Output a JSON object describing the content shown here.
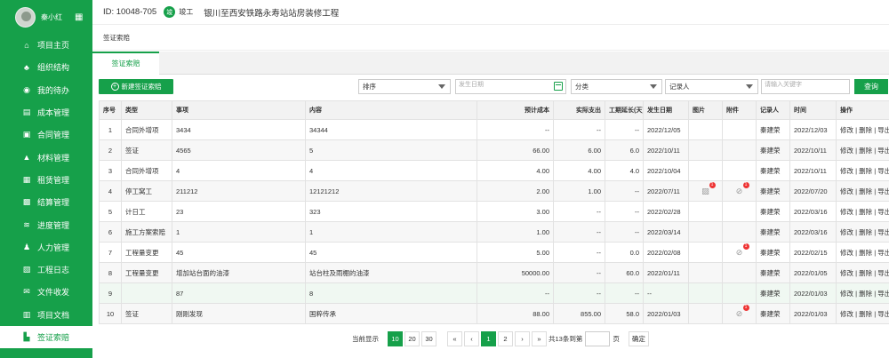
{
  "user": {
    "name": "秦小红",
    "avatar_icon": "avatar-photo",
    "qr_icon": "qrcode-icon"
  },
  "sidebar": {
    "items": [
      {
        "label": "项目主页",
        "icon": "⌂"
      },
      {
        "label": "组织结构",
        "icon": "♣"
      },
      {
        "label": "我的待办",
        "icon": "◉"
      },
      {
        "label": "成本管理",
        "icon": "▤"
      },
      {
        "label": "合同管理",
        "icon": "▣"
      },
      {
        "label": "材料管理",
        "icon": "▲"
      },
      {
        "label": "租赁管理",
        "icon": "▦"
      },
      {
        "label": "结算管理",
        "icon": "▩"
      },
      {
        "label": "进度管理",
        "icon": "≋"
      },
      {
        "label": "人力管理",
        "icon": "♟"
      },
      {
        "label": "工程日志",
        "icon": "▧"
      },
      {
        "label": "文件收发",
        "icon": "✉"
      },
      {
        "label": "项目文档",
        "icon": "▥"
      },
      {
        "label": "签证索赔",
        "icon": "▙"
      }
    ],
    "active_index": 13
  },
  "header": {
    "id": "ID: 10048-705",
    "status": "竣工",
    "status_icon": "竣",
    "project": "银川至西安铁路永寿站站房装修工程"
  },
  "breadcrumb": "签证索赔",
  "tab": "签证索赔",
  "toolbar": {
    "new_button": "新建签证索赔",
    "sort": "排序",
    "date_placeholder": "发生日期",
    "category": "分类",
    "recorder": "记录人",
    "keyword_placeholder": "请输入关键字",
    "search": "查询"
  },
  "table": {
    "headers": [
      "序号",
      "类型",
      "事项",
      "内容",
      "预计成本",
      "实际支出",
      "工期延长(天)",
      "发生日期",
      "图片",
      "附件",
      "记录人",
      "时间",
      "操作"
    ],
    "rows": [
      {
        "no": "1",
        "type": "合同外增项",
        "item": "3434",
        "content": "34344",
        "est": "--",
        "actual": "--",
        "ext": "--",
        "date": "2022/12/05",
        "img": "",
        "att": "",
        "rec": "秦建荣",
        "time": "2022/12/03",
        "ops": "修改 | 删除 | 导出"
      },
      {
        "no": "2",
        "type": "签证",
        "item": "4565",
        "content": "5",
        "est": "66.00",
        "actual": "6.00",
        "ext": "6.0",
        "date": "2022/10/11",
        "img": "",
        "att": "",
        "rec": "秦建荣",
        "time": "2022/10/11",
        "ops": "修改 | 删除 | 导出"
      },
      {
        "no": "3",
        "type": "合同外增项",
        "item": "4",
        "content": "4",
        "est": "4.00",
        "actual": "4.00",
        "ext": "4.0",
        "date": "2022/10/04",
        "img": "",
        "att": "",
        "rec": "秦建荣",
        "time": "2022/10/11",
        "ops": "修改 | 删除 | 导出"
      },
      {
        "no": "4",
        "type": "停工窝工",
        "item": "211212",
        "content": "12121212",
        "est": "2.00",
        "actual": "1.00",
        "ext": "--",
        "date": "2022/07/11",
        "img": "1",
        "att": "1",
        "rec": "秦建荣",
        "time": "2022/07/20",
        "ops": "修改 | 删除 | 导出"
      },
      {
        "no": "5",
        "type": "计日工",
        "item": "23",
        "content": "323",
        "est": "3.00",
        "actual": "--",
        "ext": "--",
        "date": "2022/02/28",
        "img": "",
        "att": "",
        "rec": "秦建荣",
        "time": "2022/03/16",
        "ops": "修改 | 删除 | 导出"
      },
      {
        "no": "6",
        "type": "施工方案索赔",
        "item": "1",
        "content": "1",
        "est": "1.00",
        "actual": "--",
        "ext": "--",
        "date": "2022/03/14",
        "img": "",
        "att": "",
        "rec": "秦建荣",
        "time": "2022/03/16",
        "ops": "修改 | 删除 | 导出"
      },
      {
        "no": "7",
        "type": "工程量变更",
        "item": "45",
        "content": "45",
        "est": "5.00",
        "actual": "--",
        "ext": "0.0",
        "date": "2022/02/08",
        "img": "",
        "att": "1",
        "rec": "秦建荣",
        "time": "2022/02/15",
        "ops": "修改 | 删除 | 导出"
      },
      {
        "no": "8",
        "type": "工程量变更",
        "item": "增加站台面的油漆",
        "content": "站台柱及雨棚的油漆",
        "est": "50000.00",
        "actual": "--",
        "ext": "60.0",
        "date": "2022/01/11",
        "img": "",
        "att": "",
        "rec": "秦建荣",
        "time": "2022/01/05",
        "ops": "修改 | 删除 | 导出"
      },
      {
        "no": "9",
        "type": "",
        "item": "87",
        "content": "8",
        "est": "--",
        "actual": "--",
        "ext": "--",
        "date": "--",
        "img": "",
        "att": "",
        "rec": "秦建荣",
        "time": "2022/01/03",
        "ops": "修改 | 删除 | 导出"
      },
      {
        "no": "10",
        "type": "签证",
        "item": "刚刚发现",
        "content": "国粹传承",
        "est": "88.00",
        "actual": "855.00",
        "ext": "58.0",
        "date": "2022/01/03",
        "img": "",
        "att": "1",
        "rec": "秦建荣",
        "time": "2022/01/03",
        "ops": "修改 | 删除 | 导出"
      }
    ]
  },
  "pager": {
    "per_page_label": "当前显示",
    "sizes": [
      "10",
      "20",
      "30"
    ],
    "pages": [
      "1",
      "2"
    ],
    "current": "1",
    "total": "共13条",
    "goto_label": "到第",
    "page_unit": "页",
    "confirm": "确定",
    "first": "«",
    "prev": "‹",
    "next": "›",
    "last": "»"
  },
  "colors": {
    "primary": "#16a04a",
    "badge": "#e33333"
  }
}
